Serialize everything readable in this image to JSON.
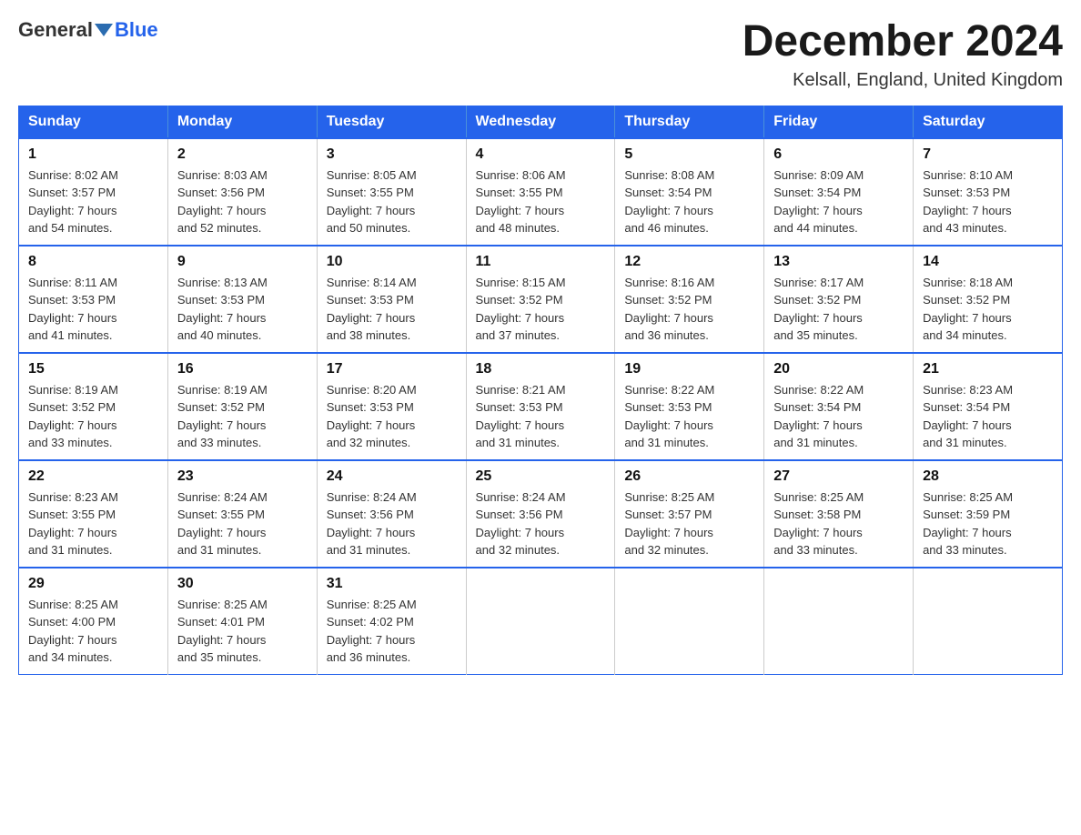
{
  "header": {
    "logo_general": "General",
    "logo_blue": "Blue",
    "month_title": "December 2024",
    "location": "Kelsall, England, United Kingdom"
  },
  "weekdays": [
    "Sunday",
    "Monday",
    "Tuesday",
    "Wednesday",
    "Thursday",
    "Friday",
    "Saturday"
  ],
  "weeks": [
    [
      {
        "day": "1",
        "sunrise": "8:02 AM",
        "sunset": "3:57 PM",
        "daylight": "7 hours and 54 minutes."
      },
      {
        "day": "2",
        "sunrise": "8:03 AM",
        "sunset": "3:56 PM",
        "daylight": "7 hours and 52 minutes."
      },
      {
        "day": "3",
        "sunrise": "8:05 AM",
        "sunset": "3:55 PM",
        "daylight": "7 hours and 50 minutes."
      },
      {
        "day": "4",
        "sunrise": "8:06 AM",
        "sunset": "3:55 PM",
        "daylight": "7 hours and 48 minutes."
      },
      {
        "day": "5",
        "sunrise": "8:08 AM",
        "sunset": "3:54 PM",
        "daylight": "7 hours and 46 minutes."
      },
      {
        "day": "6",
        "sunrise": "8:09 AM",
        "sunset": "3:54 PM",
        "daylight": "7 hours and 44 minutes."
      },
      {
        "day": "7",
        "sunrise": "8:10 AM",
        "sunset": "3:53 PM",
        "daylight": "7 hours and 43 minutes."
      }
    ],
    [
      {
        "day": "8",
        "sunrise": "8:11 AM",
        "sunset": "3:53 PM",
        "daylight": "7 hours and 41 minutes."
      },
      {
        "day": "9",
        "sunrise": "8:13 AM",
        "sunset": "3:53 PM",
        "daylight": "7 hours and 40 minutes."
      },
      {
        "day": "10",
        "sunrise": "8:14 AM",
        "sunset": "3:53 PM",
        "daylight": "7 hours and 38 minutes."
      },
      {
        "day": "11",
        "sunrise": "8:15 AM",
        "sunset": "3:52 PM",
        "daylight": "7 hours and 37 minutes."
      },
      {
        "day": "12",
        "sunrise": "8:16 AM",
        "sunset": "3:52 PM",
        "daylight": "7 hours and 36 minutes."
      },
      {
        "day": "13",
        "sunrise": "8:17 AM",
        "sunset": "3:52 PM",
        "daylight": "7 hours and 35 minutes."
      },
      {
        "day": "14",
        "sunrise": "8:18 AM",
        "sunset": "3:52 PM",
        "daylight": "7 hours and 34 minutes."
      }
    ],
    [
      {
        "day": "15",
        "sunrise": "8:19 AM",
        "sunset": "3:52 PM",
        "daylight": "7 hours and 33 minutes."
      },
      {
        "day": "16",
        "sunrise": "8:19 AM",
        "sunset": "3:52 PM",
        "daylight": "7 hours and 33 minutes."
      },
      {
        "day": "17",
        "sunrise": "8:20 AM",
        "sunset": "3:53 PM",
        "daylight": "7 hours and 32 minutes."
      },
      {
        "day": "18",
        "sunrise": "8:21 AM",
        "sunset": "3:53 PM",
        "daylight": "7 hours and 31 minutes."
      },
      {
        "day": "19",
        "sunrise": "8:22 AM",
        "sunset": "3:53 PM",
        "daylight": "7 hours and 31 minutes."
      },
      {
        "day": "20",
        "sunrise": "8:22 AM",
        "sunset": "3:54 PM",
        "daylight": "7 hours and 31 minutes."
      },
      {
        "day": "21",
        "sunrise": "8:23 AM",
        "sunset": "3:54 PM",
        "daylight": "7 hours and 31 minutes."
      }
    ],
    [
      {
        "day": "22",
        "sunrise": "8:23 AM",
        "sunset": "3:55 PM",
        "daylight": "7 hours and 31 minutes."
      },
      {
        "day": "23",
        "sunrise": "8:24 AM",
        "sunset": "3:55 PM",
        "daylight": "7 hours and 31 minutes."
      },
      {
        "day": "24",
        "sunrise": "8:24 AM",
        "sunset": "3:56 PM",
        "daylight": "7 hours and 31 minutes."
      },
      {
        "day": "25",
        "sunrise": "8:24 AM",
        "sunset": "3:56 PM",
        "daylight": "7 hours and 32 minutes."
      },
      {
        "day": "26",
        "sunrise": "8:25 AM",
        "sunset": "3:57 PM",
        "daylight": "7 hours and 32 minutes."
      },
      {
        "day": "27",
        "sunrise": "8:25 AM",
        "sunset": "3:58 PM",
        "daylight": "7 hours and 33 minutes."
      },
      {
        "day": "28",
        "sunrise": "8:25 AM",
        "sunset": "3:59 PM",
        "daylight": "7 hours and 33 minutes."
      }
    ],
    [
      {
        "day": "29",
        "sunrise": "8:25 AM",
        "sunset": "4:00 PM",
        "daylight": "7 hours and 34 minutes."
      },
      {
        "day": "30",
        "sunrise": "8:25 AM",
        "sunset": "4:01 PM",
        "daylight": "7 hours and 35 minutes."
      },
      {
        "day": "31",
        "sunrise": "8:25 AM",
        "sunset": "4:02 PM",
        "daylight": "7 hours and 36 minutes."
      },
      null,
      null,
      null,
      null
    ]
  ],
  "labels": {
    "sunrise": "Sunrise:",
    "sunset": "Sunset:",
    "daylight": "Daylight:"
  }
}
